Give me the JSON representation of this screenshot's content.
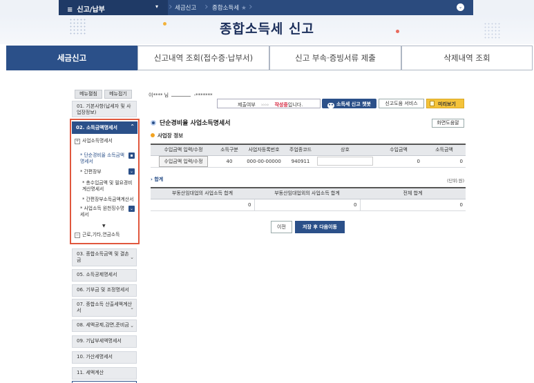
{
  "topbar": {
    "menu_title": "신고/납부",
    "crumb1": "세금신고",
    "crumb2": "종합소득세",
    "star": "★",
    "menu_toggle": "⌄"
  },
  "header": {
    "title": "종합소득세 신고"
  },
  "tabs": [
    {
      "label": "세금신고"
    },
    {
      "label": "신고내역 조회(접수증·납부서)"
    },
    {
      "label": "신고 부속·증빙서류 제출"
    },
    {
      "label": "삭제내역 조회"
    }
  ],
  "sidebar": {
    "edit_label": "메뉴펼침",
    "fold_label": "메뉴접기",
    "item01": "01. 기본사항(납세자 및 사업장정보)",
    "item02": "02. 소득금액명세서",
    "sub_business": "사업소득명세서",
    "sub_simple": "* 단순경비율 소득금액명세서",
    "sub_simple_ledger": "* 간편장부",
    "sub_sub1": "* 총수입금액 및 필요경비 계산명세서",
    "sub_sub2": "* 간편장부소득금액계산서",
    "sub_withholding": "* 사업소득 원천징수명세서",
    "sub_wage": "근로,기타,연금소득",
    "item03": "03. 종합소득금액 및 결손금",
    "item05": "05. 소득공제명세서",
    "item06": "06. 기부금 및 조정명세서",
    "item07": "07. 종합소득 산출세액계산서",
    "item08": "08. 세액공제,감면,준비금",
    "item09": "09. 기납부세액명세서",
    "item10": "10. 가산세명세서",
    "item11": "11. 세액계산"
  },
  "content": {
    "user_label": "이**** 님",
    "user_id_tail": "-*******",
    "status_prefix": "제출여부",
    "status_arrows": "›››› ",
    "status_value": "작성중",
    "status_suffix": "입니다.",
    "chat_btn": "소득세 신고 챗봇",
    "help_service_btn": "신고도움 서비스",
    "preview_btn": "미리보기",
    "section_title": "단순경비율 사업소득명세서",
    "screen_help_btn": "화면도움말",
    "subsection_title": "사업장 정보",
    "table1_headers": [
      "수입금액 입력/수정",
      "소득구분",
      "사업자등록번호",
      "주업종코드",
      "상호",
      "수입금액",
      "소득금액"
    ],
    "table1_row": {
      "edit_btn": "수입금액 입력/수정",
      "income_type": "40",
      "biz_no": "000-00-00000",
      "industry_code": "940911",
      "company": "",
      "revenue": "0",
      "income": "0"
    },
    "total_label": "› 합계",
    "unit_label": "(단위:원)",
    "table2_headers": [
      "부동산임대업의 사업소득 합계",
      "부동산임대업외의 사업소득 합계",
      "전체 합계"
    ],
    "table2_row": [
      "0",
      "0",
      "0"
    ],
    "prev_btn": "이전",
    "next_btn": "저장 후 다음이동"
  },
  "colors": {
    "primary": "#2b5089",
    "nav": "#2b4b7e",
    "accent_red": "#d4203a",
    "highlight_border": "#e0573d",
    "preview_yellow": "#f4c33a"
  }
}
